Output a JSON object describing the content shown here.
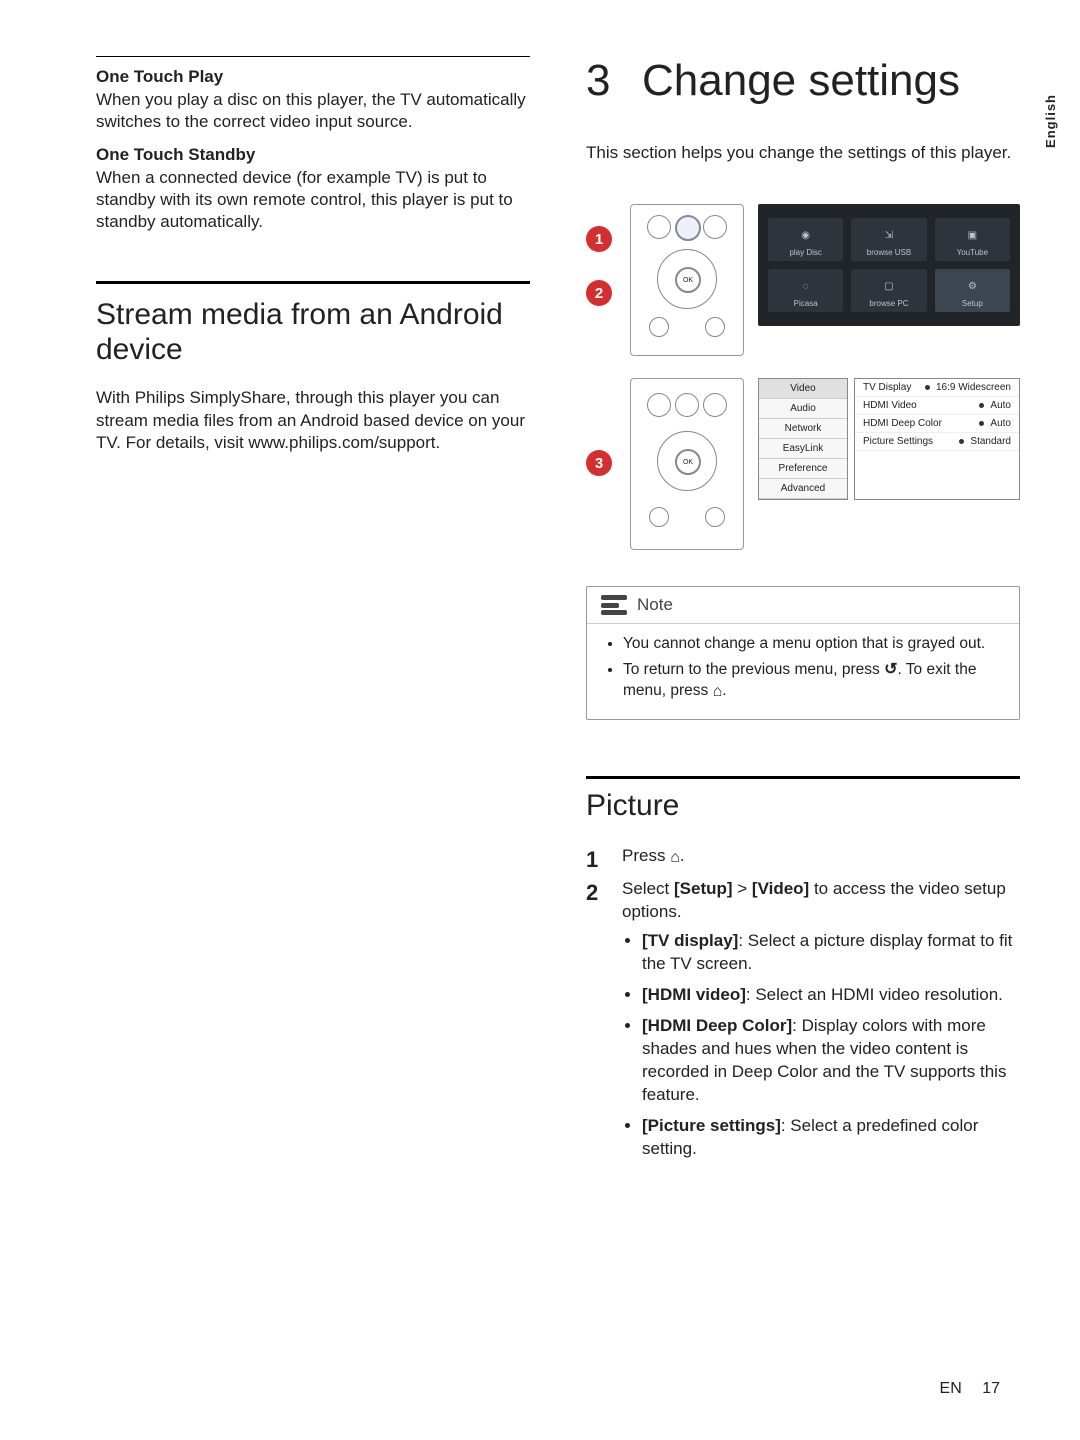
{
  "side_tab": "English",
  "left": {
    "oneTouchPlay": {
      "title": "One Touch Play",
      "body": "When you play a disc on this player, the TV automatically switches to the correct video input source."
    },
    "oneTouchStandby": {
      "title": "One Touch Standby",
      "body": "When a connected device (for example TV) is put to standby with its own remote control, this player is put to standby automatically."
    },
    "stream": {
      "heading": "Stream media from an Android device",
      "body": "With Philips SimplyShare, through this player you can stream media files from an Android based device on your TV. For details, visit www.philips.com/support."
    }
  },
  "right": {
    "chapter_num": "3",
    "chapter_title": "Change settings",
    "intro": "This section helps you change the settings of this player.",
    "markers": [
      "1",
      "2",
      "3"
    ],
    "home_tiles": [
      "play Disc",
      "browse USB",
      "YouTube",
      "Picasa",
      "browse PC",
      "Setup"
    ],
    "settings_cats": [
      "Video",
      "Audio",
      "Network",
      "EasyLink",
      "Preference",
      "Advanced"
    ],
    "settings_rows": [
      {
        "k": "TV Display",
        "v": "16:9 Widescreen"
      },
      {
        "k": "HDMI Video",
        "v": "Auto"
      },
      {
        "k": "HDMI Deep Color",
        "v": "Auto"
      },
      {
        "k": "Picture Settings",
        "v": "Standard"
      }
    ],
    "note": {
      "title": "Note",
      "items": [
        "You cannot change a menu option that is grayed out.",
        "To return to the previous menu, press ↺. To exit the menu, press ⌂."
      ]
    },
    "picture": {
      "heading": "Picture",
      "step1": "Press ⌂.",
      "step2_lead": "Select [Setup] > [Video] to access the video setup options.",
      "opts": [
        {
          "k": "[TV display]",
          "v": ": Select a picture display format to fit the TV screen."
        },
        {
          "k": "[HDMI video]",
          "v": ": Select an HDMI video resolution."
        },
        {
          "k": "[HDMI Deep Color]",
          "v": ": Display colors with more shades and hues when the video content is recorded in Deep Color and the TV supports this feature."
        },
        {
          "k": "[Picture settings]",
          "v": ": Select a predefined color setting."
        }
      ]
    }
  },
  "footer": {
    "lang": "EN",
    "page": "17"
  }
}
